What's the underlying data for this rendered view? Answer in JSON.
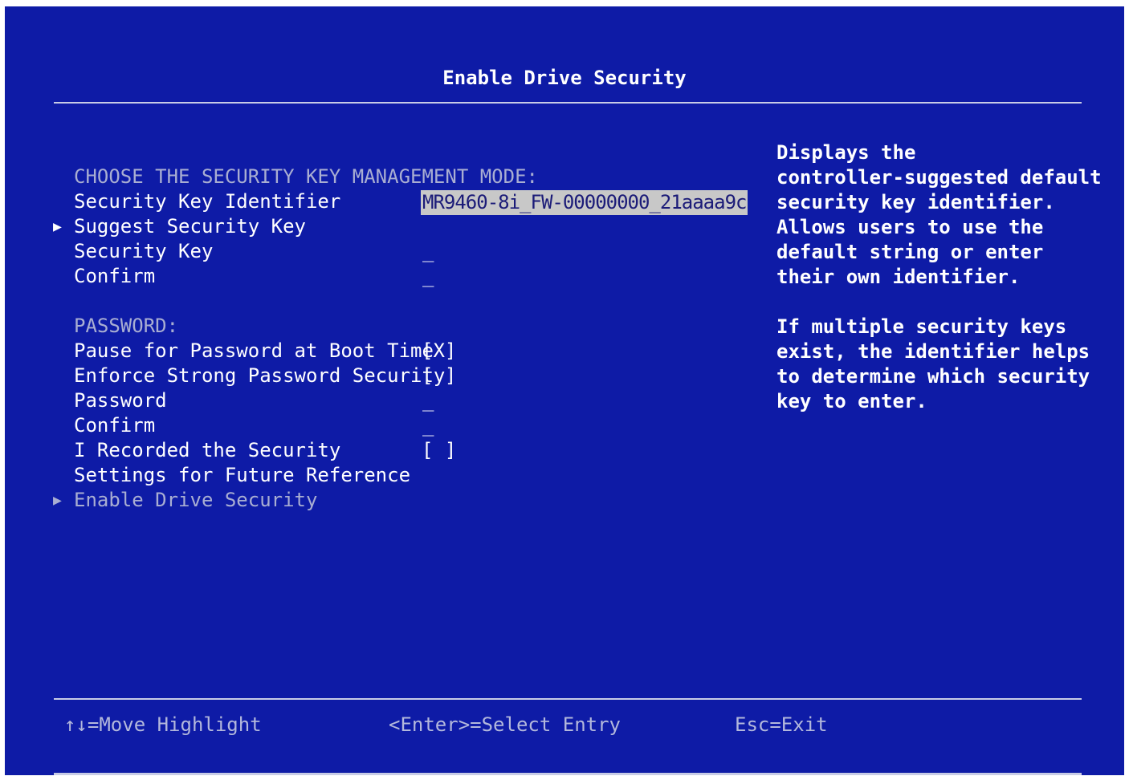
{
  "title": "Enable Drive Security",
  "key_section": {
    "heading": "CHOOSE THE SECURITY KEY MANAGEMENT MODE:",
    "identifier_label": "Security Key Identifier",
    "identifier_value": "MR9460-8i_FW-00000000_21aaaa9c",
    "suggest_label": "Suggest Security Key",
    "key_label": "Security Key",
    "key_value": "_",
    "confirm_label": "Confirm",
    "confirm_value": "_"
  },
  "password_section": {
    "heading": "PASSWORD:",
    "pause_label": "Pause for Password at Boot Time",
    "pause_value": "[X]",
    "strong_label": "Enforce Strong Password Security",
    "strong_value": "[ ]",
    "password_label": "Password",
    "password_value": "_",
    "confirm_label": "Confirm",
    "confirm_value": "_",
    "recorded_label_line1": "I Recorded the Security",
    "recorded_value": "[ ]",
    "recorded_label_line2": "Settings for Future Reference",
    "enable_label": "Enable Drive Security"
  },
  "help": {
    "lines": [
      "Displays the",
      "controller-suggested default",
      "security key identifier.",
      "Allows users to use the",
      "default string or enter",
      "their own identifier.",
      "",
      "If multiple security keys",
      "exist, the identifier helps",
      "to determine which security",
      "key to enter."
    ]
  },
  "footer": {
    "move": "↑↓=Move Highlight",
    "select": "<Enter>=Select Entry",
    "exit": "Esc=Exit"
  },
  "colors": {
    "background": "#0e1ba6",
    "text": "#ffffff",
    "dim_text": "#a9aed2",
    "highlight_bg": "#c8c8c8",
    "highlight_fg": "#1b1b78"
  }
}
